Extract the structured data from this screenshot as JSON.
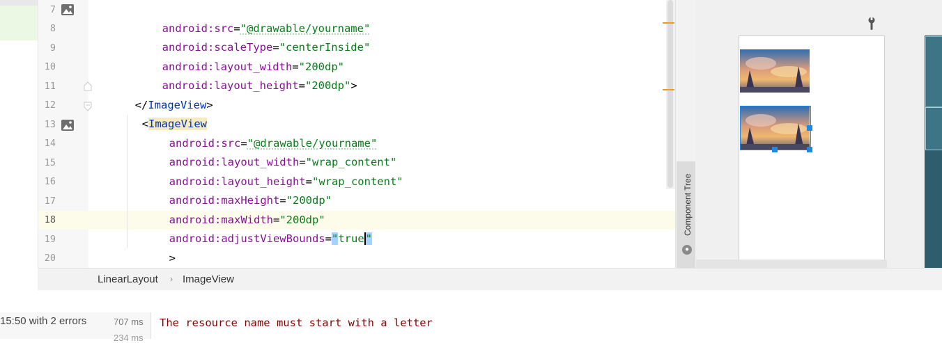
{
  "editor": {
    "line_numbers": [
      "7",
      "8",
      "9",
      "10",
      "11",
      "12",
      "13",
      "14",
      "15",
      "16",
      "17",
      "18",
      "19",
      "20"
    ],
    "current_line": "18",
    "lines": {
      "l7": {
        "attr": "android:src",
        "eq": "=",
        "val": "\"@drawable/yourname\""
      },
      "l8": {
        "attr": "android:scaleType",
        "eq": "=",
        "val": "\"centerInside\""
      },
      "l9": {
        "attr": "android:layout_width",
        "eq": "=",
        "val": "\"200dp\""
      },
      "l10": {
        "attr": "android:layout_height",
        "eq": "=",
        "val": "\"200dp\"",
        "tail": ">"
      },
      "l11": {
        "open": "</",
        "tag": "ImageView",
        "close": ">"
      },
      "l12": {
        "open": "<",
        "tag": "ImageView"
      },
      "l13": {
        "attr": "android:src",
        "eq": "=",
        "val": "\"@drawable/yourname\""
      },
      "l14": {
        "attr": "android:layout_width",
        "eq": "=",
        "val": "\"wrap_content\""
      },
      "l15": {
        "attr": "android:layout_height",
        "eq": "=",
        "val": "\"wrap_content\""
      },
      "l16": {
        "attr": "android:maxHeight",
        "eq": "=",
        "val": "\"200dp\""
      },
      "l17": {
        "attr": "android:maxWidth",
        "eq": "=",
        "val": "\"200dp\""
      },
      "l18": {
        "attr": "android:adjustViewBounds",
        "eq": "=",
        "q1": "\"",
        "val": "true",
        "q2": "\""
      },
      "l19": {
        "text": ">"
      }
    }
  },
  "side_tabs": {
    "component_tree": "Component Tree"
  },
  "breadcrumb": {
    "items": [
      "LinearLayout",
      "ImageView"
    ],
    "separator": "›"
  },
  "build": {
    "status": "15:50 with 2 errors",
    "time1": "707 ms",
    "time2": "234 ms"
  },
  "messages": {
    "error": "The resource name must start with a letter"
  },
  "colors": {
    "attribute": "#871094",
    "string": "#067d17",
    "tag": "#0033b3",
    "error": "#8b0000",
    "selection_handle": "#1e88e5"
  },
  "icons": [
    "image-gutter-icon",
    "fold-icon",
    "wrench-icon",
    "globe-icon"
  ]
}
